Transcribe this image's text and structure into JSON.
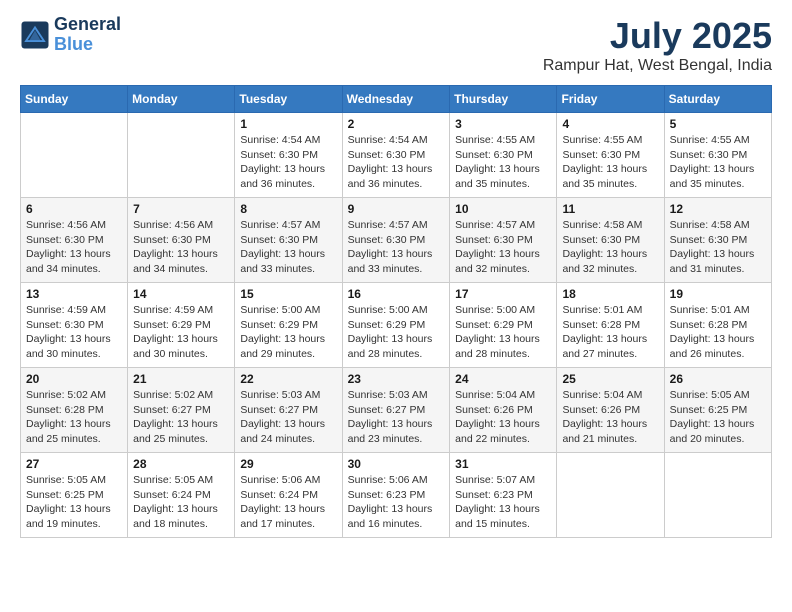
{
  "header": {
    "logo_line1": "General",
    "logo_line2": "Blue",
    "month_year": "July 2025",
    "location": "Rampur Hat, West Bengal, India"
  },
  "weekdays": [
    "Sunday",
    "Monday",
    "Tuesday",
    "Wednesday",
    "Thursday",
    "Friday",
    "Saturday"
  ],
  "weeks": [
    [
      {
        "day": "",
        "info": ""
      },
      {
        "day": "",
        "info": ""
      },
      {
        "day": "1",
        "info": "Sunrise: 4:54 AM\nSunset: 6:30 PM\nDaylight: 13 hours and 36 minutes."
      },
      {
        "day": "2",
        "info": "Sunrise: 4:54 AM\nSunset: 6:30 PM\nDaylight: 13 hours and 36 minutes."
      },
      {
        "day": "3",
        "info": "Sunrise: 4:55 AM\nSunset: 6:30 PM\nDaylight: 13 hours and 35 minutes."
      },
      {
        "day": "4",
        "info": "Sunrise: 4:55 AM\nSunset: 6:30 PM\nDaylight: 13 hours and 35 minutes."
      },
      {
        "day": "5",
        "info": "Sunrise: 4:55 AM\nSunset: 6:30 PM\nDaylight: 13 hours and 35 minutes."
      }
    ],
    [
      {
        "day": "6",
        "info": "Sunrise: 4:56 AM\nSunset: 6:30 PM\nDaylight: 13 hours and 34 minutes."
      },
      {
        "day": "7",
        "info": "Sunrise: 4:56 AM\nSunset: 6:30 PM\nDaylight: 13 hours and 34 minutes."
      },
      {
        "day": "8",
        "info": "Sunrise: 4:57 AM\nSunset: 6:30 PM\nDaylight: 13 hours and 33 minutes."
      },
      {
        "day": "9",
        "info": "Sunrise: 4:57 AM\nSunset: 6:30 PM\nDaylight: 13 hours and 33 minutes."
      },
      {
        "day": "10",
        "info": "Sunrise: 4:57 AM\nSunset: 6:30 PM\nDaylight: 13 hours and 32 minutes."
      },
      {
        "day": "11",
        "info": "Sunrise: 4:58 AM\nSunset: 6:30 PM\nDaylight: 13 hours and 32 minutes."
      },
      {
        "day": "12",
        "info": "Sunrise: 4:58 AM\nSunset: 6:30 PM\nDaylight: 13 hours and 31 minutes."
      }
    ],
    [
      {
        "day": "13",
        "info": "Sunrise: 4:59 AM\nSunset: 6:30 PM\nDaylight: 13 hours and 30 minutes."
      },
      {
        "day": "14",
        "info": "Sunrise: 4:59 AM\nSunset: 6:29 PM\nDaylight: 13 hours and 30 minutes."
      },
      {
        "day": "15",
        "info": "Sunrise: 5:00 AM\nSunset: 6:29 PM\nDaylight: 13 hours and 29 minutes."
      },
      {
        "day": "16",
        "info": "Sunrise: 5:00 AM\nSunset: 6:29 PM\nDaylight: 13 hours and 28 minutes."
      },
      {
        "day": "17",
        "info": "Sunrise: 5:00 AM\nSunset: 6:29 PM\nDaylight: 13 hours and 28 minutes."
      },
      {
        "day": "18",
        "info": "Sunrise: 5:01 AM\nSunset: 6:28 PM\nDaylight: 13 hours and 27 minutes."
      },
      {
        "day": "19",
        "info": "Sunrise: 5:01 AM\nSunset: 6:28 PM\nDaylight: 13 hours and 26 minutes."
      }
    ],
    [
      {
        "day": "20",
        "info": "Sunrise: 5:02 AM\nSunset: 6:28 PM\nDaylight: 13 hours and 25 minutes."
      },
      {
        "day": "21",
        "info": "Sunrise: 5:02 AM\nSunset: 6:27 PM\nDaylight: 13 hours and 25 minutes."
      },
      {
        "day": "22",
        "info": "Sunrise: 5:03 AM\nSunset: 6:27 PM\nDaylight: 13 hours and 24 minutes."
      },
      {
        "day": "23",
        "info": "Sunrise: 5:03 AM\nSunset: 6:27 PM\nDaylight: 13 hours and 23 minutes."
      },
      {
        "day": "24",
        "info": "Sunrise: 5:04 AM\nSunset: 6:26 PM\nDaylight: 13 hours and 22 minutes."
      },
      {
        "day": "25",
        "info": "Sunrise: 5:04 AM\nSunset: 6:26 PM\nDaylight: 13 hours and 21 minutes."
      },
      {
        "day": "26",
        "info": "Sunrise: 5:05 AM\nSunset: 6:25 PM\nDaylight: 13 hours and 20 minutes."
      }
    ],
    [
      {
        "day": "27",
        "info": "Sunrise: 5:05 AM\nSunset: 6:25 PM\nDaylight: 13 hours and 19 minutes."
      },
      {
        "day": "28",
        "info": "Sunrise: 5:05 AM\nSunset: 6:24 PM\nDaylight: 13 hours and 18 minutes."
      },
      {
        "day": "29",
        "info": "Sunrise: 5:06 AM\nSunset: 6:24 PM\nDaylight: 13 hours and 17 minutes."
      },
      {
        "day": "30",
        "info": "Sunrise: 5:06 AM\nSunset: 6:23 PM\nDaylight: 13 hours and 16 minutes."
      },
      {
        "day": "31",
        "info": "Sunrise: 5:07 AM\nSunset: 6:23 PM\nDaylight: 13 hours and 15 minutes."
      },
      {
        "day": "",
        "info": ""
      },
      {
        "day": "",
        "info": ""
      }
    ]
  ]
}
